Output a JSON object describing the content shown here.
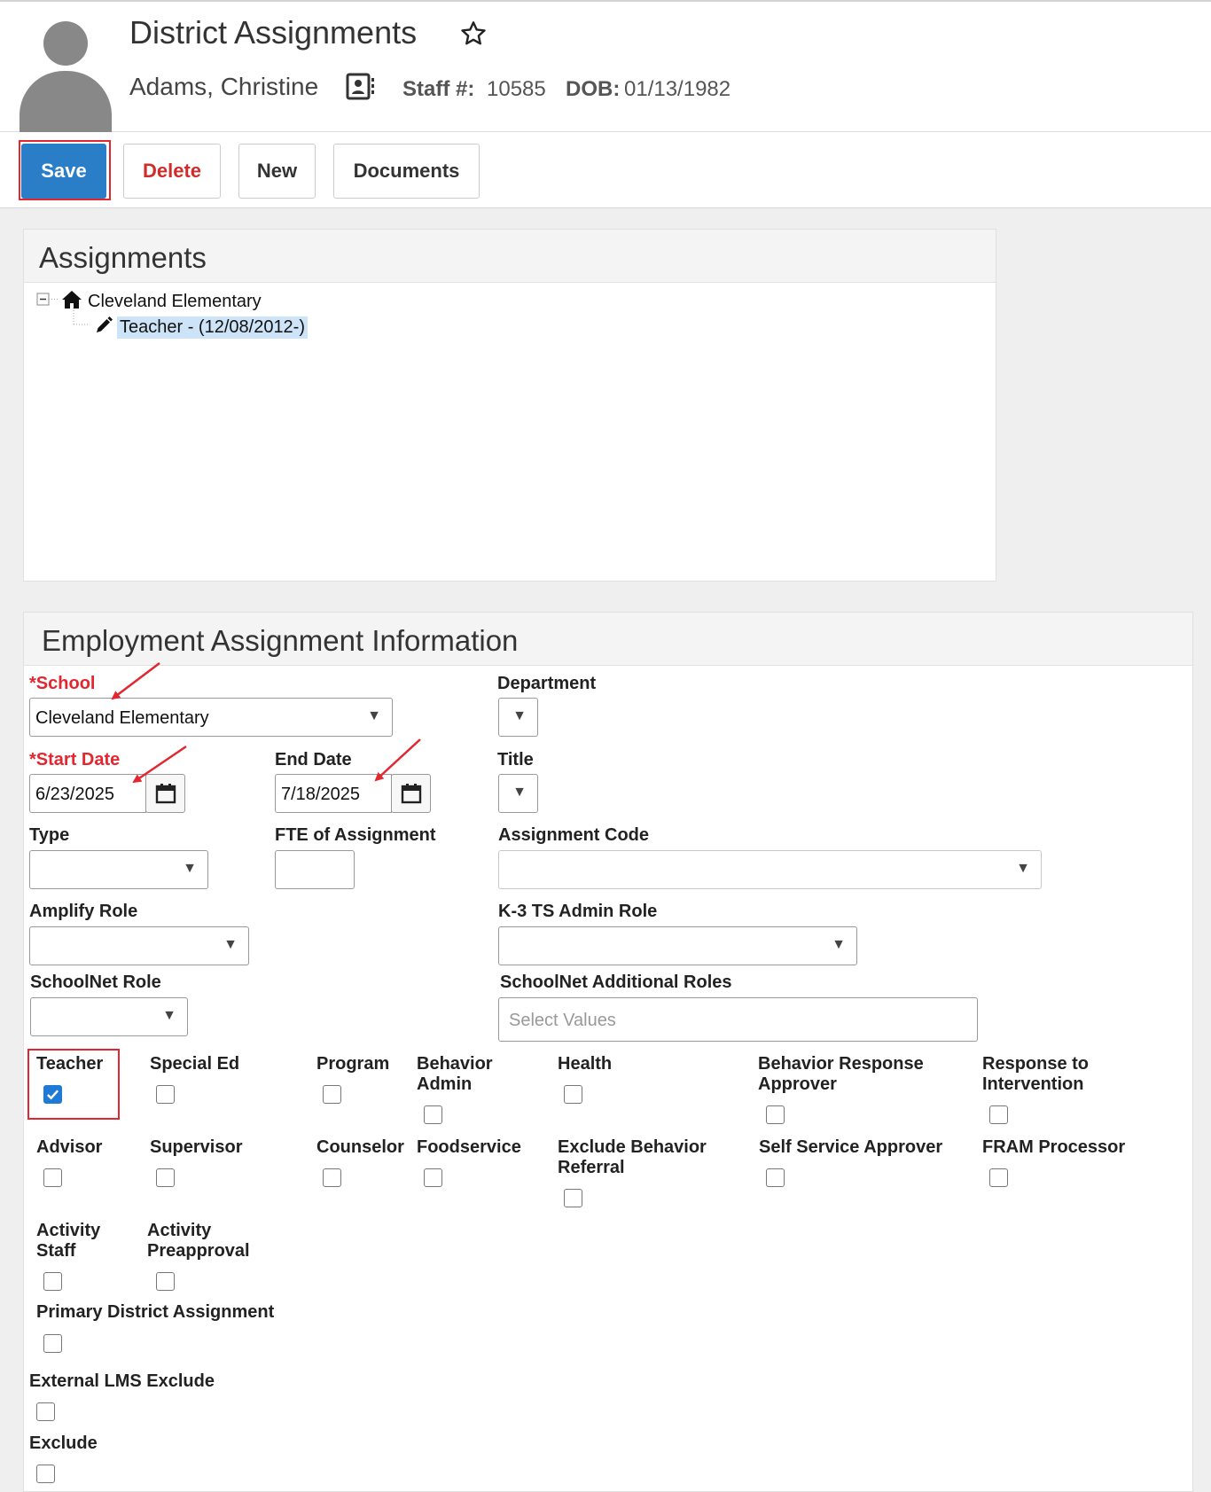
{
  "header": {
    "title": "District Assignments",
    "person_name": "Adams, Christine",
    "staff_label": "Staff #:",
    "staff_number": "10585",
    "dob_label": "DOB:",
    "dob": "01/13/1982"
  },
  "toolbar": {
    "save": "Save",
    "delete": "Delete",
    "new": "New",
    "documents": "Documents"
  },
  "assignments": {
    "title": "Assignments",
    "school": "Cleveland Elementary",
    "item": "Teacher - (12/08/2012-)"
  },
  "employment": {
    "title": "Employment Assignment Information",
    "school_label": "School",
    "school_value": "Cleveland Elementary",
    "department_label": "Department",
    "start_date_label": "Start Date",
    "start_date": "6/23/2025",
    "end_date_label": "End Date",
    "end_date": "7/18/2025",
    "title_label": "Title",
    "type_label": "Type",
    "fte_label": "FTE of Assignment",
    "assignment_code_label": "Assignment Code",
    "amplify_label": "Amplify Role",
    "k3_label": "K-3 TS Admin Role",
    "schoolnet_label": "SchoolNet Role",
    "schoolnet_additional_label": "SchoolNet Additional Roles",
    "schoolnet_additional_placeholder": "Select Values",
    "checkboxes": {
      "teacher": {
        "label": "Teacher",
        "checked": true
      },
      "special_ed": {
        "label": "Special Ed",
        "checked": false
      },
      "program": {
        "label": "Program",
        "checked": false
      },
      "behavior_admin": {
        "label1": "Behavior",
        "label2": "Admin",
        "checked": false
      },
      "health": {
        "label": "Health",
        "checked": false
      },
      "behavior_response": {
        "label1": "Behavior Response",
        "label2": "Approver",
        "checked": false
      },
      "rti": {
        "label1": "Response to",
        "label2": "Intervention",
        "checked": false
      },
      "advisor": {
        "label": "Advisor",
        "checked": false
      },
      "supervisor": {
        "label": "Supervisor",
        "checked": false
      },
      "counselor": {
        "label": "Counselor",
        "checked": false
      },
      "foodservice": {
        "label": "Foodservice",
        "checked": false
      },
      "exclude_behavior": {
        "label1": "Exclude Behavior",
        "label2": "Referral",
        "checked": false
      },
      "self_service": {
        "label": "Self Service Approver",
        "checked": false
      },
      "fram": {
        "label": "FRAM Processor",
        "checked": false
      },
      "activity_staff": {
        "label1": "Activity",
        "label2": "Staff",
        "checked": false
      },
      "activity_preapproval": {
        "label1": "Activity",
        "label2": "Preapproval",
        "checked": false
      },
      "primary_district": {
        "label": "Primary District Assignment",
        "checked": false
      },
      "external_lms": {
        "label": "External LMS Exclude",
        "checked": false
      },
      "exclude": {
        "label": "Exclude",
        "checked": false
      }
    }
  },
  "colors": {
    "primary": "#2a7ec8",
    "required": "#e3262f",
    "delete": "#d12c2c",
    "highlight": "#e3262f"
  }
}
